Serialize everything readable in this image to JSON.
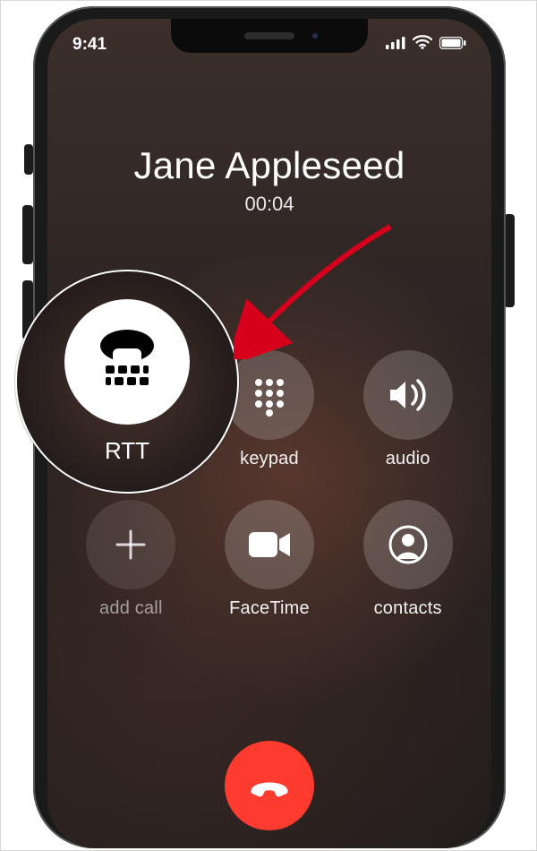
{
  "status": {
    "time": "9:41"
  },
  "caller": {
    "name": "Jane Appleseed",
    "duration": "00:04"
  },
  "buttons": {
    "rtt": "RTT",
    "keypad": "keypad",
    "audio": "audio",
    "addcall": "add call",
    "facetime": "FaceTime",
    "contacts": "contacts"
  },
  "callout": {
    "label": "RTT"
  }
}
